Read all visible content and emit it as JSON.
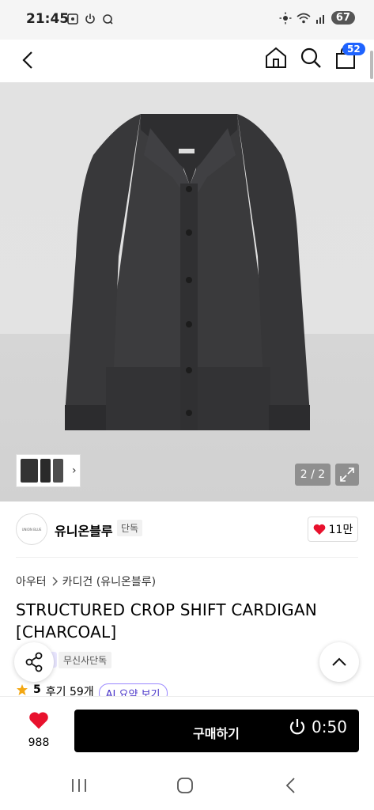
{
  "status_bar": {
    "time": "21:45",
    "battery": "67"
  },
  "header": {
    "cart_count": "52"
  },
  "gallery": {
    "counter": "2 / 2"
  },
  "brand": {
    "name": "유니온블루",
    "logo_text": "UNION BLUE",
    "tag": "단독",
    "likes": "11만"
  },
  "breadcrumb": {
    "level1": "아우터",
    "level2": "카디건 (유니온블루)"
  },
  "product": {
    "title": "STRUCTURED CROP SHIFT CARDIGAN [CHARCOAL]",
    "exclusive_tag": "무신사단독",
    "rating": "5",
    "review_count": "후기 59개",
    "ai_summary": "AI 요약 보기"
  },
  "bottom": {
    "like_count": "988",
    "buy_label": "구매하기",
    "timer": "0:50"
  },
  "colors": {
    "accent": "#1e63ff",
    "heart": "#e8112d",
    "cardigan": "#3c3c3e"
  }
}
